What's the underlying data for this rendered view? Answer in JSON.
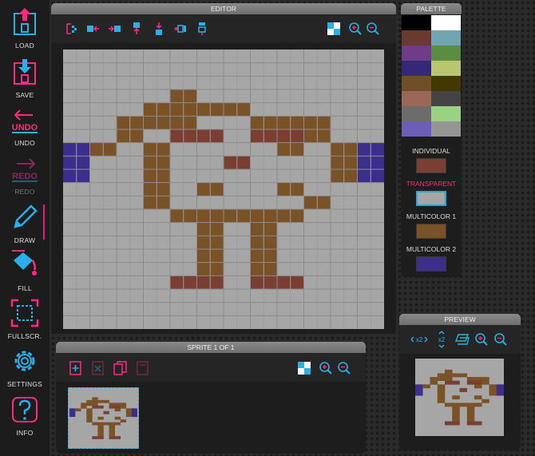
{
  "toolbar": {
    "items": [
      {
        "label": "LOAD",
        "icon": "load-icon",
        "enabled": true
      },
      {
        "label": "SAVE",
        "icon": "save-icon",
        "enabled": true
      },
      {
        "label": "UNDO",
        "icon": "undo-icon",
        "enabled": true
      },
      {
        "label": "REDO",
        "icon": "redo-icon",
        "enabled": false
      },
      {
        "label": "DRAW",
        "icon": "pencil-icon",
        "enabled": true,
        "active": true
      },
      {
        "label": "FILL",
        "icon": "paint-bucket-icon",
        "enabled": true
      },
      {
        "label": "FULLSCR.",
        "icon": "fullscreen-icon",
        "enabled": true
      },
      {
        "label": "SETTINGS",
        "icon": "gear-icon",
        "enabled": true
      },
      {
        "label": "INFO",
        "icon": "info-icon",
        "enabled": true
      }
    ],
    "undo_icon_text": "UNDO",
    "redo_icon_text": "REDO"
  },
  "editor": {
    "title": "EDITOR",
    "tools": [
      "flip-icon",
      "shift-left-icon",
      "shift-right-icon",
      "shift-up-icon",
      "shift-down-icon",
      "mirror-horizontal-icon",
      "mirror-vertical-icon"
    ],
    "view_tools": [
      "grid-toggle-icon",
      "zoom-in-icon",
      "zoom-out-icon"
    ]
  },
  "palette": {
    "title": "PALETTE",
    "colors": [
      "#000000",
      "#ffffff",
      "#6b3a2e",
      "#70a4b2",
      "#6f3d86",
      "#588d43",
      "#352879",
      "#b8c76f",
      "#6f4f25",
      "#433900",
      "#9a6759",
      "#444444",
      "#6c6c6c",
      "#9ad284",
      "#6c5eb5",
      "#959595"
    ],
    "selectors": [
      {
        "label": "INDIVIDUAL",
        "color": "#7a3e32"
      },
      {
        "label": "TRANSPARENT",
        "color": "#a6a6a6"
      },
      {
        "label": "MULTICOLOR 1",
        "color": "#7a5228"
      },
      {
        "label": "MULTICOLOR 2",
        "color": "#3c2e8c"
      }
    ],
    "accent_color": "#ff2a7f",
    "selection_color": "#20a8e0"
  },
  "sprite_list": {
    "title": "SPRITE 1 OF 1",
    "tools": [
      "new-sprite-icon",
      "delete-sprite-icon",
      "copy-sprite-icon",
      "paste-sprite-icon"
    ],
    "view_tools": [
      "grid-toggle-icon",
      "zoom-in-icon",
      "zoom-out-icon"
    ]
  },
  "preview": {
    "title": "PREVIEW",
    "tools": [
      "double-width-icon",
      "double-height-icon",
      "overlay-icon",
      "zoom-in-icon",
      "zoom-out-icon"
    ]
  },
  "sprite": {
    "width": 12,
    "height": 21,
    "colors": {
      "0": "#a6a6a6",
      "1": "#7a3e32",
      "2": "#7a5228",
      "3": "#3c2e8c"
    },
    "rows": [
      "000000000000",
      "000000000000",
      "000000000000",
      "000020000000",
      "000222200000",
      "002220022200",
      "002011011200",
      "320200002023",
      "300200100023",
      "300200000023",
      "000202002000",
      "000200000200",
      "000022222000",
      "000002020000",
      "000002020000",
      "000002020000",
      "000002020000",
      "000011011000",
      "000000000000",
      "000000000000",
      "000000000000"
    ]
  }
}
